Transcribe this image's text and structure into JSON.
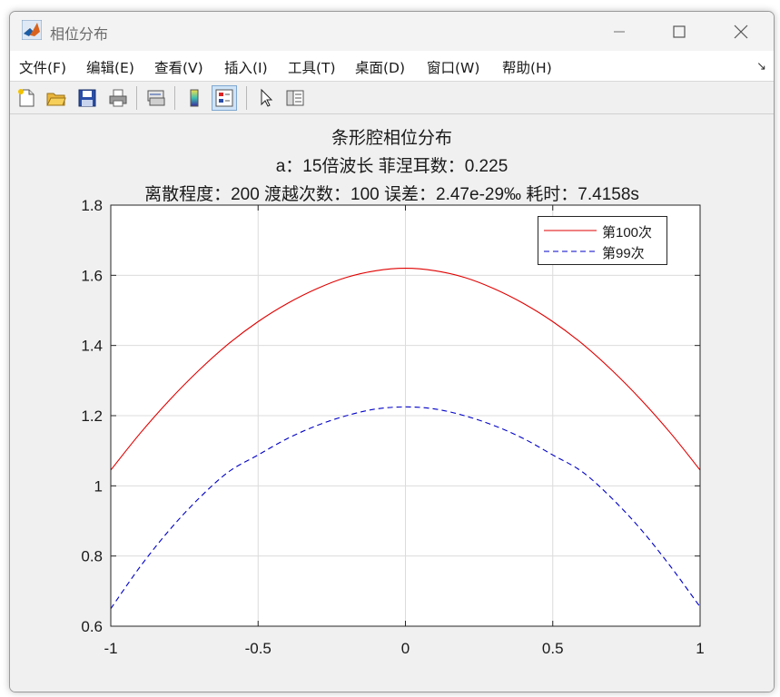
{
  "window": {
    "title": "相位分布"
  },
  "menu": {
    "items": [
      "文件(F)",
      "编辑(E)",
      "查看(V)",
      "插入(I)",
      "工具(T)",
      "桌面(D)",
      "窗口(W)",
      "帮助(H)"
    ],
    "dock_glyph": "↘"
  },
  "toolbar": {
    "icons": [
      "new-figure-icon",
      "open-file-icon",
      "save-icon",
      "print-icon",
      "link-plot-icon",
      "colorbar-icon",
      "legend-icon",
      "select-cursor-icon",
      "property-inspector-icon"
    ]
  },
  "plot": {
    "title_lines": [
      "条形腔相位分布",
      "a：15倍波长  菲涅耳数：0.225",
      "离散程度：200  渡越次数：100  误差：2.47e-29‰  耗时：7.4158s"
    ]
  },
  "chart_data": {
    "type": "line",
    "title": "条形腔相位分布",
    "xlim": [
      -1,
      1
    ],
    "ylim": [
      0.6,
      1.8
    ],
    "xticks": [
      "-1",
      "-0.5",
      "0",
      "0.5",
      "1"
    ],
    "yticks": [
      "0.6",
      "0.8",
      "1",
      "1.2",
      "1.4",
      "1.6",
      "1.8"
    ],
    "xtick_values": [
      -1,
      -0.5,
      0,
      0.5,
      1
    ],
    "ytick_values": [
      0.6,
      0.8,
      1.0,
      1.2,
      1.4,
      1.6,
      1.8
    ],
    "grid": true,
    "legend_position": "top-right",
    "series": [
      {
        "name": "第100次",
        "color": "#e00000",
        "style": "solid",
        "x": [
          -1,
          -0.9,
          -0.8,
          -0.7,
          -0.6,
          -0.5,
          -0.4,
          -0.3,
          -0.2,
          -0.1,
          0,
          0.1,
          0.2,
          0.3,
          0.4,
          0.5,
          0.6,
          0.7,
          0.8,
          0.9,
          1
        ],
        "values": [
          1.045,
          1.15,
          1.245,
          1.33,
          1.405,
          1.468,
          1.52,
          1.562,
          1.594,
          1.613,
          1.62,
          1.613,
          1.594,
          1.562,
          1.52,
          1.468,
          1.405,
          1.33,
          1.245,
          1.15,
          1.045
        ]
      },
      {
        "name": "第99次",
        "color": "#0000c8",
        "style": "dashed",
        "x": [
          -1,
          -0.9,
          -0.8,
          -0.7,
          -0.6,
          -0.5,
          -0.4,
          -0.3,
          -0.2,
          -0.1,
          0,
          0.1,
          0.2,
          0.3,
          0.4,
          0.5,
          0.6,
          0.7,
          0.8,
          0.9,
          1
        ],
        "values": [
          0.65,
          0.77,
          0.875,
          0.965,
          1.04,
          1.088,
          1.135,
          1.172,
          1.2,
          1.219,
          1.225,
          1.219,
          1.2,
          1.172,
          1.135,
          1.088,
          1.04,
          0.965,
          0.875,
          0.77,
          0.655
        ]
      }
    ]
  }
}
